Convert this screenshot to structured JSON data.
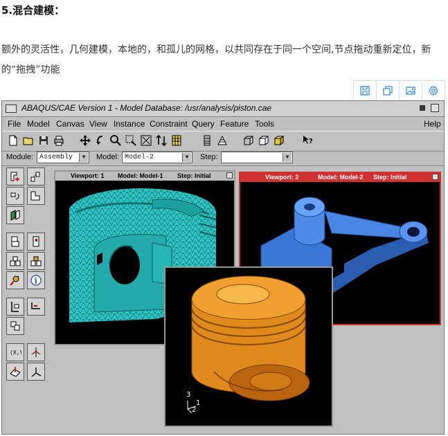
{
  "article": {
    "heading": "5.混合建模：",
    "paragraph": "额外的灵活性，几何建模，本地的，和孤儿的网格，以共同存在于同一个空间,节点拖动重新定位，新的“拖拽”功能"
  },
  "image_tools": [
    "save-icon",
    "copy-icon",
    "image-icon",
    "settings-icon"
  ],
  "app": {
    "title": "ABAQUS/CAE Version 1 - Model Database: /usr/analysis/piston.cae",
    "menu": [
      "File",
      "Model",
      "Canvas",
      "View",
      "Instance",
      "Constraint",
      "Query",
      "Feature",
      "Tools",
      "Help"
    ],
    "context": {
      "module_label": "Module:",
      "module_value": "Assembly",
      "model_label": "Model:",
      "model_value": "Model-2",
      "step_label": "Step:",
      "step_value": ""
    },
    "viewports": [
      {
        "viewport": "Viewport: 1",
        "model": "Model: Model-1",
        "step": "Step: Initial"
      },
      {
        "viewport": "Viewport: 2",
        "model": "Model: Model-2",
        "step": "Step: Initial"
      }
    ],
    "triad": {
      "axis3": "3",
      "axis1": "1",
      "axis2": "2"
    },
    "colors": {
      "mesh_part": "#2fc4c4",
      "assembly_part": "#3a78d8",
      "piston_part": "#e08a1e",
      "active_viewport": "#d03030"
    }
  }
}
